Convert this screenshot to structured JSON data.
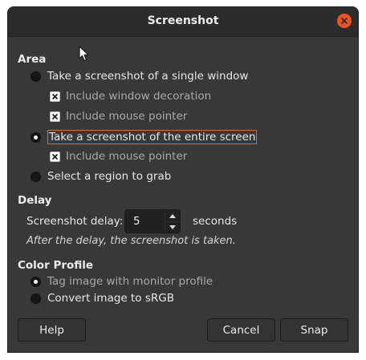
{
  "window": {
    "title": "Screenshot"
  },
  "area": {
    "heading": "Area",
    "single_window": "Take a screenshot of a single window",
    "include_decoration": "Include window decoration",
    "include_pointer_window": "Include mouse pointer",
    "entire_screen": "Take a screenshot of the entire screen",
    "include_pointer_screen": "Include mouse pointer",
    "region": "Select a region to grab",
    "selected_option": "entire_screen"
  },
  "delay": {
    "heading": "Delay",
    "label": "Screenshot delay:",
    "value": "5",
    "unit": "seconds",
    "note": "After the delay, the screenshot is taken."
  },
  "color_profile": {
    "heading": "Color Profile",
    "tag_monitor": "Tag image with monitor profile",
    "convert_srgb": "Convert image to sRGB",
    "selected_option": "tag_monitor"
  },
  "buttons": {
    "help": "Help",
    "cancel": "Cancel",
    "snap": "Snap"
  },
  "colors": {
    "accent": "#e95420",
    "background": "#383838",
    "titlebar": "#2c2c2c"
  },
  "icons": {
    "close": "close-icon",
    "pointer": "mouse-pointer-icon",
    "spin_up": "chevron-up-icon",
    "spin_down": "chevron-down-icon"
  }
}
